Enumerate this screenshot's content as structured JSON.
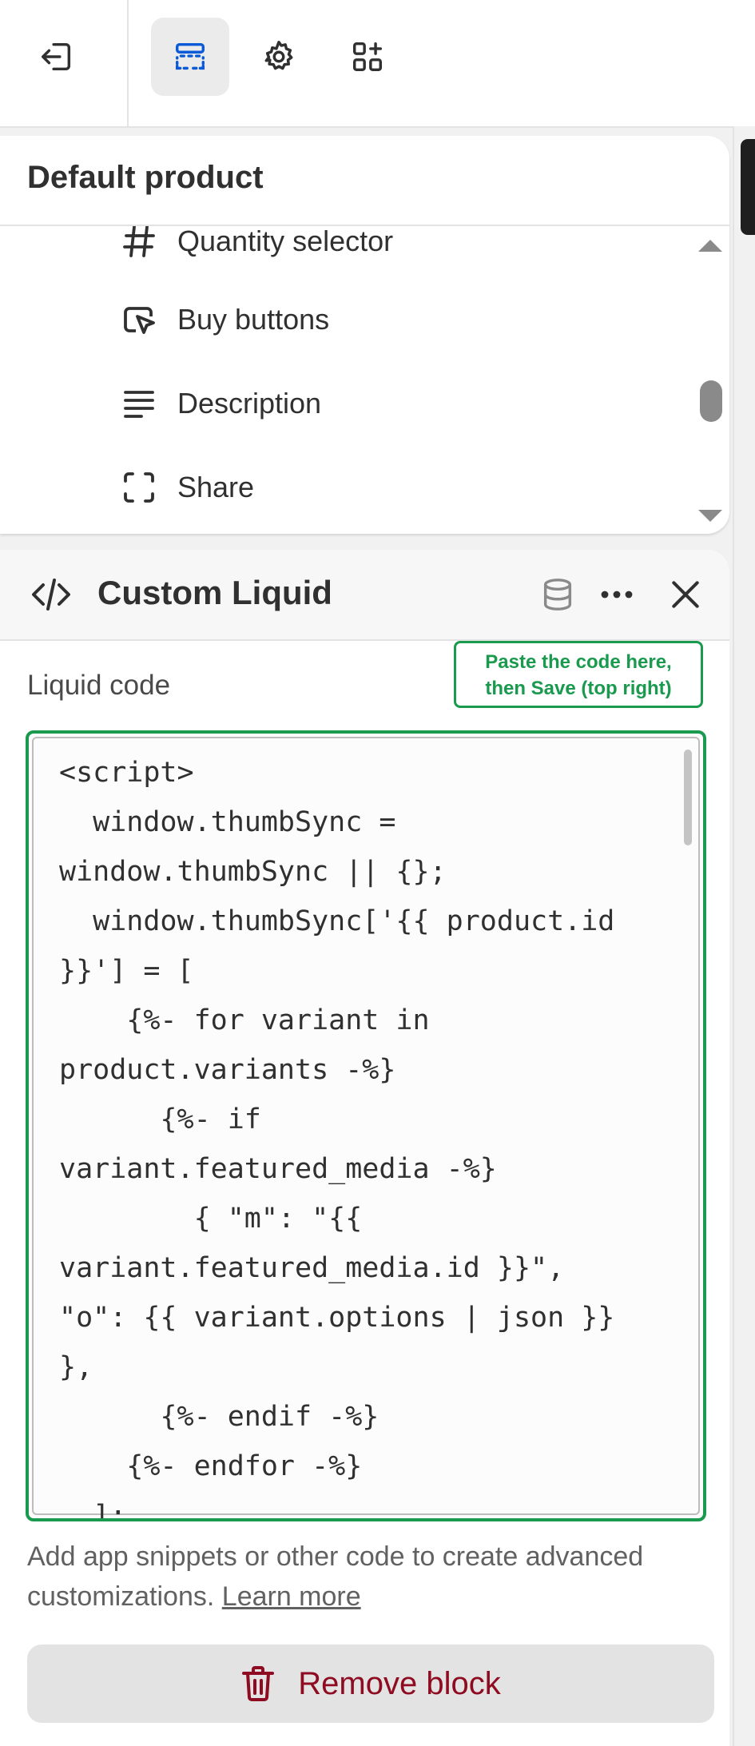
{
  "toolbar": {
    "items": [
      {
        "icon": "exit-icon"
      },
      {
        "icon": "sections-icon",
        "active": true
      },
      {
        "icon": "gear-icon"
      },
      {
        "icon": "apps-add-icon"
      }
    ]
  },
  "product_panel": {
    "title": "Default product",
    "blocks": [
      {
        "label": "Quantity selector",
        "icon": "hash-icon"
      },
      {
        "label": "Buy buttons",
        "icon": "cursor-click-icon"
      },
      {
        "label": "Description",
        "icon": "text-lines-icon"
      },
      {
        "label": "Share",
        "icon": "share-frame-icon"
      }
    ]
  },
  "block_editor": {
    "title": "Custom Liquid",
    "field_label": "Liquid code",
    "hint": "Paste the code here,\nthen Save (top right)",
    "code": "<script>\n  window.thumbSync =\nwindow.thumbSync || {};\n  window.thumbSync['{{ product.id\n}}'] = [\n    {%- for variant in\nproduct.variants -%}\n      {%- if\nvariant.featured_media -%}\n        { \"m\": \"{{\nvariant.featured_media.id }}\",\n\"o\": {{ variant.options | json }}\n},\n      {%- endif -%}\n    {%- endfor -%}\n  ];",
    "help_text": "Add app snippets or other code to create advanced customizations.",
    "learn_more": "Learn more",
    "remove_label": "Remove block"
  },
  "colors": {
    "accent_green": "#1a9a4e",
    "active_blue": "#0a59d6",
    "danger": "#8e0b21"
  }
}
